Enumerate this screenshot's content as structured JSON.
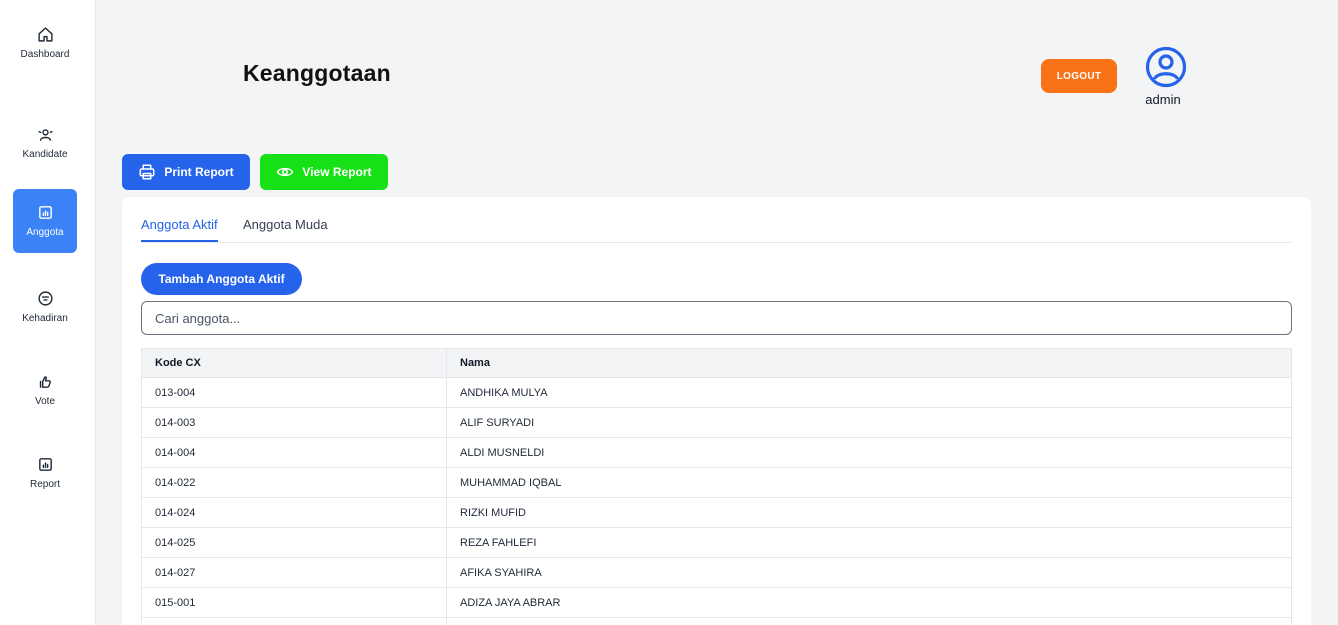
{
  "sidebar": {
    "items": [
      {
        "label": "Dashboard",
        "icon": "home-icon"
      },
      {
        "label": "Kandidate",
        "icon": "users-icon"
      },
      {
        "label": "Anggota",
        "icon": "chart-icon",
        "active": true
      },
      {
        "label": "Kehadiran",
        "icon": "clock-icon"
      },
      {
        "label": "Vote",
        "icon": "hand-icon"
      },
      {
        "label": "Report",
        "icon": "chart-icon"
      }
    ]
  },
  "header": {
    "title": "Keanggotaan",
    "logout_label": "LOGOUT",
    "user_name": "admin"
  },
  "actions": {
    "print_label": "Print Report",
    "view_label": "View Report"
  },
  "tabs": [
    {
      "label": "Anggota Aktif",
      "active": true
    },
    {
      "label": "Anggota Muda",
      "active": false
    }
  ],
  "add_button_label": "Tambah Anggota Aktif",
  "search": {
    "placeholder": "Cari anggota...",
    "value": ""
  },
  "table": {
    "columns": [
      "Kode CX",
      "Nama"
    ],
    "rows": [
      [
        "013-004",
        "ANDHIKA MULYA"
      ],
      [
        "014-003",
        "ALIF SURYADI"
      ],
      [
        "014-004",
        "ALDI MUSNELDI"
      ],
      [
        "014-022",
        "MUHAMMAD IQBAL"
      ],
      [
        "014-024",
        "RIZKI MUFID"
      ],
      [
        "014-025",
        "REZA FAHLEFI"
      ],
      [
        "014-027",
        "AFIKA SYAHIRA"
      ],
      [
        "015-001",
        "ADIZA JAYA ABRAR"
      ],
      [
        "",
        ""
      ]
    ]
  },
  "colors": {
    "primary": "#2563eb",
    "active_nav": "#3b82f6",
    "logout": "#f97316",
    "view_report": "#16e016"
  }
}
